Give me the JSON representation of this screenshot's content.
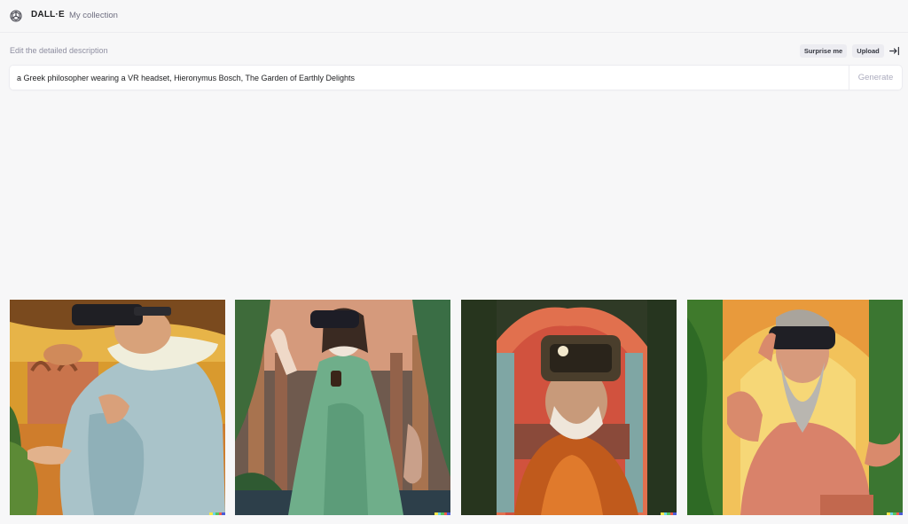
{
  "header": {
    "brand": "DALL·E",
    "nav_collection": "My collection",
    "logo_icon": "openai-logo-icon"
  },
  "editor": {
    "instruction": "Edit the detailed description",
    "surprise_label": "Surprise me",
    "upload_label": "Upload",
    "share_icon": "arrow-right-to-line-icon",
    "prompt_value": "a Greek philosopher wearing a VR headset, Hieronymus Bosch, The Garden of Earthly Delights",
    "generate_label": "Generate"
  },
  "results": {
    "images": [
      {
        "subject": "philosopher in pale blue robe with VR headset before classical ruins"
      },
      {
        "subject": "woman in green dress with VR headset holding device among pillars"
      },
      {
        "subject": "bearded man in orange robe with VR headset under sunset arches"
      },
      {
        "subject": "grey-bearded man in salmon robe adjusting VR headset in garden"
      }
    ],
    "signature_colors": [
      "#f7e84a",
      "#68d5e6",
      "#59c35c",
      "#f25a4b",
      "#4c5bd6"
    ]
  },
  "colors": {
    "background": "#f7f7f8",
    "text_primary": "#202123",
    "text_muted": "#8e8ea0",
    "button_bg": "#ececf1"
  }
}
